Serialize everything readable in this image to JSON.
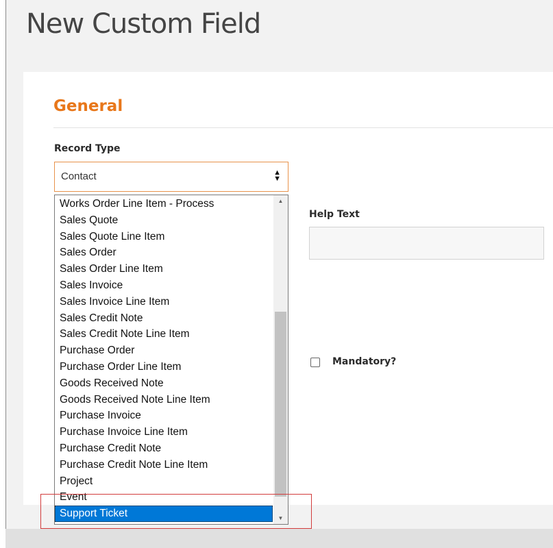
{
  "page": {
    "title": "New Custom Field"
  },
  "general": {
    "section_title": "General",
    "record_type": {
      "label": "Record Type",
      "value": "Contact",
      "options": [
        "Works Order Line Item - Process",
        "Sales Quote",
        "Sales Quote Line Item",
        "Sales Order",
        "Sales Order Line Item",
        "Sales Invoice",
        "Sales Invoice Line Item",
        "Sales Credit Note",
        "Sales Credit Note Line Item",
        "Purchase Order",
        "Purchase Order Line Item",
        "Goods Received Note",
        "Goods Received Note Line Item",
        "Purchase Invoice",
        "Purchase Invoice Line Item",
        "Purchase Credit Note",
        "Purchase Credit Note Line Item",
        "Project",
        "Event",
        "Support Ticket"
      ],
      "highlighted": "Support Ticket"
    },
    "help_text": {
      "label": "Help Text",
      "value": ""
    },
    "mandatory": {
      "label": "Mandatory?",
      "checked": false
    }
  },
  "colors": {
    "section_title": "#e8771a",
    "select_border": "#e8924a",
    "selected_option_bg": "#0078d7",
    "annotation_box": "#d23b3b"
  }
}
